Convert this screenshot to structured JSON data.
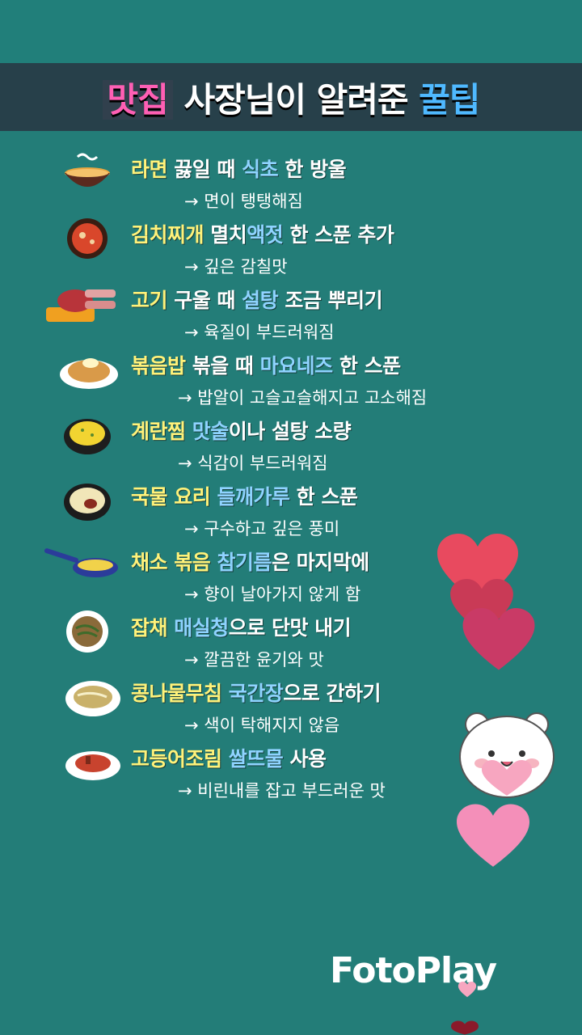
{
  "banner": {
    "part1": "맛집",
    "part2": "사장님이 알려준",
    "part3": "꿀팁"
  },
  "tips": [
    {
      "icon": "ramen-bowl-icon",
      "t": [
        "라면",
        " 끓일 때 ",
        "식초",
        " 한 방울"
      ],
      "sub": "→ 면이 탱탱해짐"
    },
    {
      "icon": "kimchi-stew-icon",
      "t": [
        "김치찌개",
        " 멸치",
        "액젓",
        " 한 스푼 추가"
      ],
      "sub": "→ 깊은 감칠맛"
    },
    {
      "icon": "grilled-meat-icon",
      "t": [
        "고기",
        " 구울 때 ",
        "설탕",
        " 조금 뿌리기"
      ],
      "sub": "→ 육질이 부드러워짐"
    },
    {
      "icon": "fried-rice-icon",
      "t": [
        "볶음밥",
        " 볶을 때 ",
        "마요네즈",
        " 한 스푼"
      ],
      "sub": "→ 밥알이 고슬고슬해지고 고소해짐"
    },
    {
      "icon": "steamed-egg-icon",
      "t": [
        "계란찜",
        " ",
        "맛술",
        "이나 설탕 소량"
      ],
      "sub": "→ 식감이 부드러워짐"
    },
    {
      "icon": "soup-bowl-icon",
      "t": [
        "국물 요리",
        " ",
        "들깨가루",
        " 한 스푼"
      ],
      "sub": "→ 구수하고 깊은 풍미"
    },
    {
      "icon": "frying-pan-icon",
      "t": [
        "채소 볶음",
        " ",
        "참기름",
        "은 마지막에"
      ],
      "sub": "→ 향이 날아가지 않게 함"
    },
    {
      "icon": "japchae-icon",
      "t": [
        "잡채",
        " ",
        "매실청",
        "으로 단맛 내기"
      ],
      "sub": "→ 깔끔한 윤기와 맛"
    },
    {
      "icon": "bean-sprouts-icon",
      "t": [
        "콩나물무침",
        " ",
        "국간장",
        "으로 간하기"
      ],
      "sub": "→ 색이 탁해지지 않음"
    },
    {
      "icon": "braised-mackerel-icon",
      "t": [
        "고등어조림",
        " ",
        "쌀뜨물",
        " 사용"
      ],
      "sub": "→ 비린내를 잡고 부드러운 맛"
    }
  ],
  "watermark": "FotoPlay",
  "colors": {
    "background": "#237d78",
    "banner": "#27404a",
    "highlight_yellow": "#fff27a",
    "highlight_blue": "#8fd3ff",
    "pink": "#ff5fb4"
  }
}
